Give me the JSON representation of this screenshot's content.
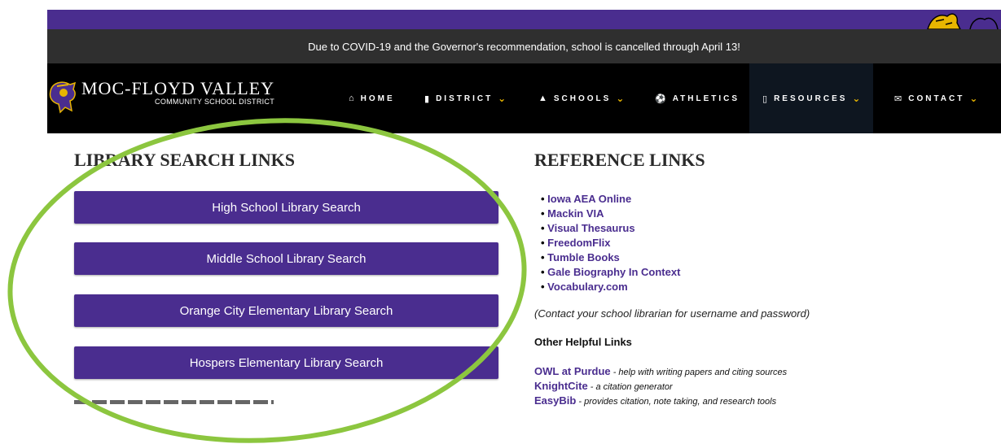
{
  "announcement": "Due to COVID-19 and the Governor's recommendation, school is cancelled through April 13!",
  "logo": {
    "title": "MOC-FLOYD VALLEY",
    "subtitle": "COMMUNITY SCHOOL DISTRICT"
  },
  "nav": [
    {
      "label": "HOME",
      "icon": "home-icon",
      "has_dropdown": false
    },
    {
      "label": "DISTRICT",
      "icon": "building-icon",
      "has_dropdown": true
    },
    {
      "label": "SCHOOLS",
      "icon": "graduation-cap-icon",
      "has_dropdown": true
    },
    {
      "label": "ATHLETICS",
      "icon": "soccer-ball-icon",
      "has_dropdown": false
    },
    {
      "label": "RESOURCES",
      "icon": "book-icon",
      "has_dropdown": true,
      "active": true
    },
    {
      "label": "CONTACT",
      "icon": "envelope-icon",
      "has_dropdown": true
    }
  ],
  "library": {
    "title": "LIBRARY SEARCH LINKS",
    "buttons": [
      "High School Library Search",
      "Middle School Library Search",
      "Orange City Elementary Library Search",
      "Hospers Elementary Library Search"
    ]
  },
  "reference": {
    "title": "REFERENCE LINKS",
    "links": [
      "Iowa AEA Online",
      "Mackin VIA",
      "Visual Thesaurus",
      "FreedomFlix",
      "Tumble Books",
      "Gale Biography In Context",
      "Vocabulary.com"
    ],
    "note": "(Contact your school librarian for username and password)",
    "other_title": "Other Helpful Links",
    "other_links": [
      {
        "name": "OWL at Purdue",
        "desc": " - help with writing papers and citing sources"
      },
      {
        "name": "KnightCite",
        "desc": " - a citation generator"
      },
      {
        "name": "EasyBib",
        "desc": " - provides citation, note taking, and research tools"
      }
    ]
  },
  "colors": {
    "brand_purple": "#4a2d8f",
    "accent_gold": "#e8b500",
    "highlight_green": "#8cc63f"
  }
}
